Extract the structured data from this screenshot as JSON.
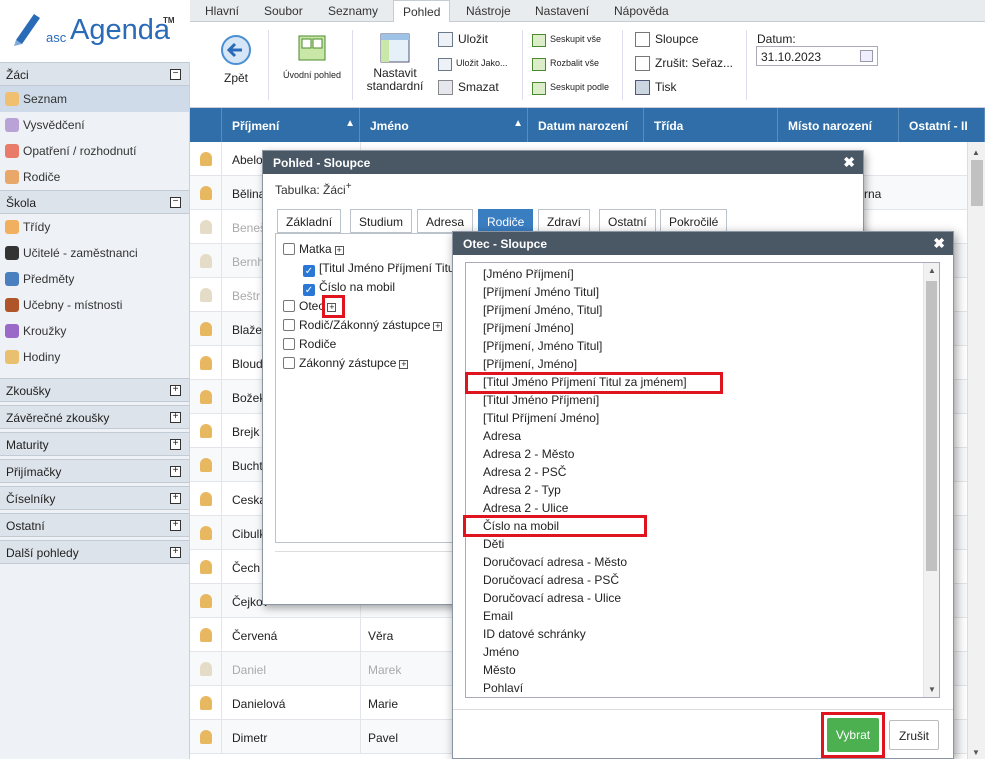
{
  "app": {
    "logo_small": "asc",
    "logo_main": "Agenda",
    "logo_tm": "TM"
  },
  "menu_tabs": [
    "Hlavní",
    "Soubor",
    "Seznamy",
    "Pohled",
    "Nástroje",
    "Nastavení",
    "Nápověda"
  ],
  "active_tab": "Pohled",
  "ribbon": {
    "back": "Zpět",
    "home_view": "Úvodní pohled",
    "set_default": "Nastavit standardní",
    "save": "Uložit",
    "save_as": "Uložit Jako...",
    "delete": "Smazat",
    "group_all": "Seskupit vše",
    "expand_all": "Rozbalit vše",
    "group_by": "Seskupit podle",
    "columns": "Sloupce",
    "cancel_sort": "Zrušit: Seřaz...",
    "print": "Tisk",
    "date_label": "Datum:",
    "date_value": "31.10.2023"
  },
  "sidebar": {
    "sections": [
      {
        "label": "Žáci",
        "expanded": true,
        "items": [
          "Seznam",
          "Vysvědčení",
          "Opatření / rozhodnutí",
          "Rodiče"
        ]
      },
      {
        "label": "Škola",
        "expanded": true,
        "items": [
          "Třídy",
          "Učitelé - zaměstnanci",
          "Předměty",
          "Učebny - místnosti",
          "Kroužky",
          "Hodiny"
        ]
      },
      {
        "label": "Zkoušky"
      },
      {
        "label": "Závěrečné zkoušky"
      },
      {
        "label": "Maturity"
      },
      {
        "label": "Přijímačky"
      },
      {
        "label": "Číselníky"
      },
      {
        "label": "Ostatní"
      },
      {
        "label": "Další pohledy"
      }
    ],
    "selected": "Seznam"
  },
  "grid": {
    "headers": [
      "Příjmení",
      "Jméno",
      "Datum narození",
      "Třída",
      "Místo narození",
      "Ostatní - II"
    ],
    "rows": [
      {
        "surname": "Abelo",
        "name": ""
      },
      {
        "surname": "Bělina",
        "name": "",
        "extra": "rna"
      },
      {
        "surname": "Beneš",
        "name": ""
      },
      {
        "surname": "Bernh",
        "name": ""
      },
      {
        "surname": "Beštr",
        "name": ""
      },
      {
        "surname": "Blaže",
        "name": ""
      },
      {
        "surname": "Bloud",
        "name": ""
      },
      {
        "surname": "Božek",
        "name": ""
      },
      {
        "surname": "Brejk",
        "name": ""
      },
      {
        "surname": "Bucht",
        "name": ""
      },
      {
        "surname": "Ceska",
        "name": ""
      },
      {
        "surname": "Cibulk",
        "name": ""
      },
      {
        "surname": "Čech",
        "name": ""
      },
      {
        "surname": "Čejkov",
        "name": ""
      },
      {
        "surname": "Červená",
        "name": "Věra"
      },
      {
        "surname": "Daniel",
        "name": "Marek"
      },
      {
        "surname": "Danielová",
        "name": "Marie"
      },
      {
        "surname": "Dimetr",
        "name": "Pavel"
      }
    ]
  },
  "dialog_columns": {
    "title": "Pohled - Sloupce",
    "table_label": "Tabulka: Žáci",
    "table_sup": "+",
    "tabs": [
      "Základní",
      "Studium",
      "Adresa",
      "Rodiče",
      "Zdraví",
      "Ostatní",
      "Pokročilé"
    ],
    "active_tab": "Rodiče",
    "tree": [
      {
        "label": "Matka",
        "checked": false,
        "expandable": true,
        "indent": 0
      },
      {
        "label": "[Titul Jméno Příjmení Titu",
        "checked": true,
        "indent": 1
      },
      {
        "label": "Číslo na mobil",
        "checked": true,
        "indent": 1
      },
      {
        "label": "Otec",
        "checked": false,
        "expandable": true,
        "indent": 0
      },
      {
        "label": "Rodič/Zákonný zástupce",
        "checked": false,
        "expandable": true,
        "indent": 0
      },
      {
        "label": "Rodiče",
        "checked": false,
        "indent": 0
      },
      {
        "label": "Zákonný zástupce",
        "checked": false,
        "expandable": true,
        "indent": 0
      }
    ]
  },
  "dialog_father": {
    "title": "Otec - Sloupce",
    "items": [
      "[Jméno Příjmení]",
      "[Příjmení Jméno Titul]",
      "[Příjmení Jméno, Titul]",
      "[Příjmení Jméno]",
      "[Příjmení, Jméno Titul]",
      "[Příjmení, Jméno]",
      "[Titul Jméno Příjmení Titul za jménem]",
      "[Titul Jméno Příjmení]",
      "[Titul Příjmení Jméno]",
      "Adresa",
      "Adresa 2 - Město",
      "Adresa 2 - PSČ",
      "Adresa 2 - Typ",
      "Adresa 2 - Ulice",
      "Číslo na mobil",
      "Děti",
      "Doručovací adresa - Město",
      "Doručovací adresa - PSČ",
      "Doručovací adresa - Ulice",
      "Email",
      "ID datové schránky",
      "Jméno",
      "Město",
      "Pohlaví"
    ],
    "select_label": "Vybrat",
    "cancel_label": "Zrušit"
  },
  "colors": {
    "header_blue": "#2f6ea8",
    "active_tab_blue": "#3a7ec2",
    "dialog_head": "#4a5866",
    "select_green": "#4caf50",
    "highlight_red": "#e0141e"
  },
  "close_glyph": "✖"
}
